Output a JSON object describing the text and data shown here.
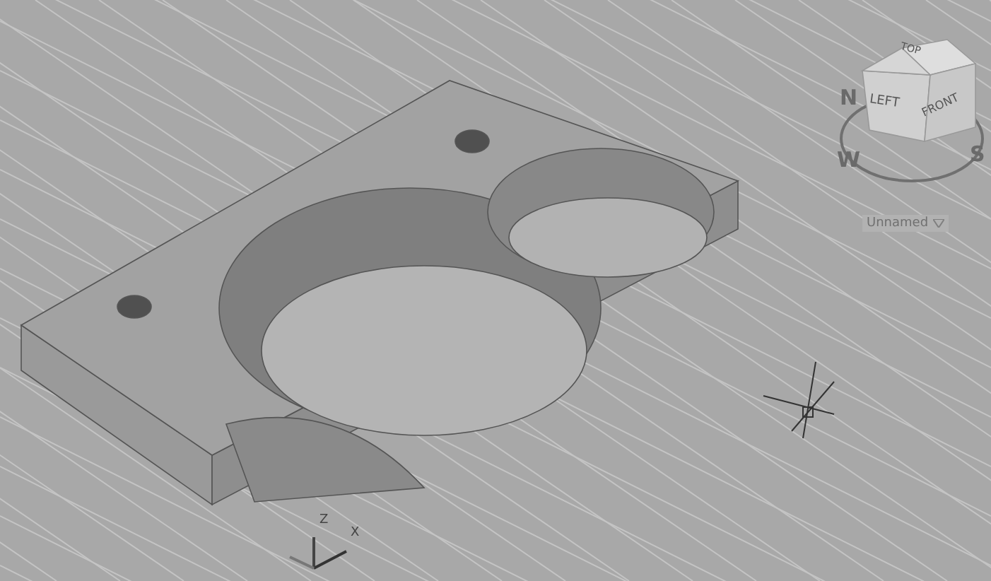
{
  "viewcube": {
    "faces": [
      {
        "label": "TOP"
      },
      {
        "label": "LEFT"
      },
      {
        "label": "FRONT"
      }
    ],
    "compass": [
      "N",
      "W",
      "S"
    ]
  },
  "view_menu": {
    "label": "Unnamed"
  },
  "ucs_icon": {
    "axes": [
      "Z",
      "X"
    ]
  }
}
